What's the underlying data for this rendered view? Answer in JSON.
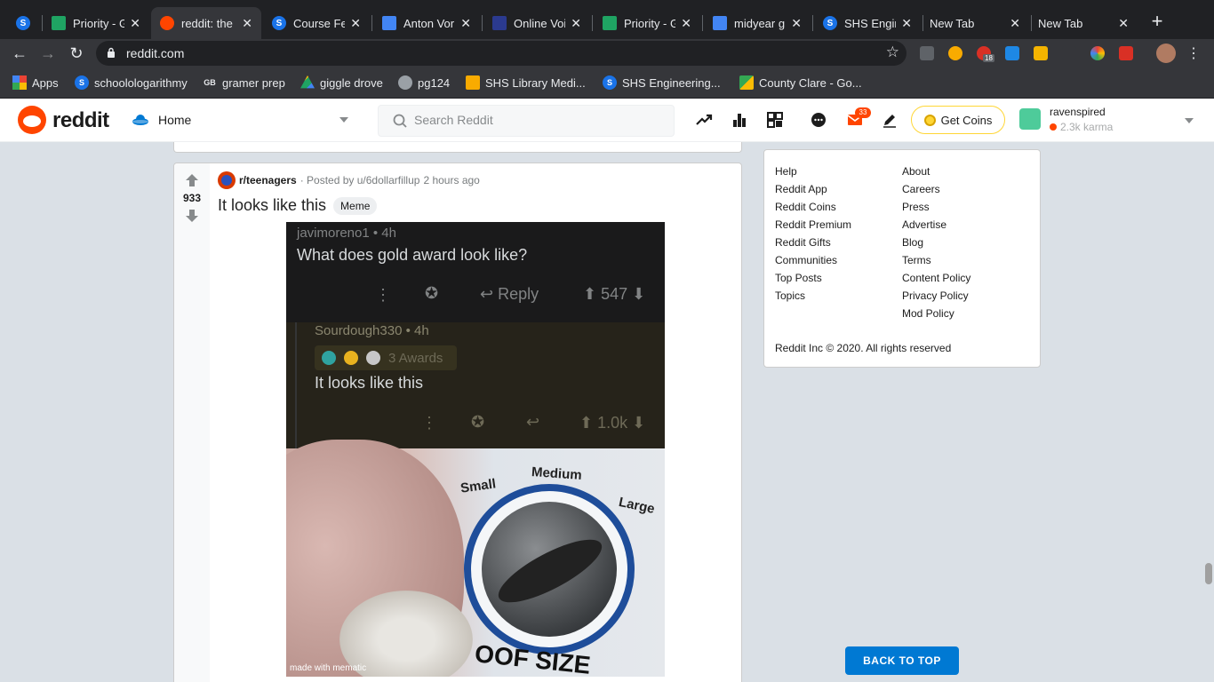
{
  "browser": {
    "tabs": [
      {
        "title": "",
        "favicon": "s-icon",
        "color": "#1a73e8"
      },
      {
        "title": "Priority - G",
        "favicon": "drive-icon",
        "color": "#1fa463"
      },
      {
        "title": "reddit: the",
        "favicon": "reddit-icon",
        "color": "#ff4500"
      },
      {
        "title": "Course Fe",
        "favicon": "s-icon",
        "color": "#1a73e8"
      },
      {
        "title": "Anton Vor",
        "favicon": "docs-icon",
        "color": "#4285f4"
      },
      {
        "title": "Online Voi",
        "favicon": "book-icon",
        "color": "#2b3a8f"
      },
      {
        "title": "Priority - G",
        "favicon": "drive-icon",
        "color": "#1fa463"
      },
      {
        "title": "midyear gr",
        "favicon": "docs-icon",
        "color": "#4285f4"
      },
      {
        "title": "SHS Engin",
        "favicon": "s-icon",
        "color": "#1a73e8"
      },
      {
        "title": "New Tab",
        "favicon": "",
        "color": ""
      },
      {
        "title": "New Tab",
        "favicon": "",
        "color": ""
      }
    ],
    "url": "reddit.com",
    "bookmarks": [
      {
        "label": "Apps",
        "icon": "apps-grid-icon"
      },
      {
        "label": "schoolologarithmy",
        "icon": "s-icon"
      },
      {
        "label": "gramer prep",
        "icon": "gb-icon"
      },
      {
        "label": "giggle drove",
        "icon": "drive-icon"
      },
      {
        "label": "pg124",
        "icon": "globe-icon"
      },
      {
        "label": "SHS Library Medi...",
        "icon": "library-icon"
      },
      {
        "label": "SHS Engineering...",
        "icon": "s-icon"
      },
      {
        "label": "County Clare - Go...",
        "icon": "maps-icon"
      }
    ],
    "extensions": {
      "badge": "18"
    }
  },
  "reddit_header": {
    "brand": "reddit",
    "feed_selector": "Home",
    "search_placeholder": "Search Reddit",
    "mail_badge": "33",
    "get_coins": "Get Coins",
    "username": "ravenspired",
    "karma": "2.3k karma"
  },
  "post": {
    "score": "933",
    "subreddit": "r/teenagers",
    "posted_by": "· Posted by u/6dollarfillup",
    "time": "2 hours ago",
    "title": "It looks like this",
    "flair": "Meme",
    "image": {
      "comment1": {
        "user": "javimoreno1 • 4h",
        "body": "What does gold award look like?",
        "reply": "Reply",
        "score": "547"
      },
      "comment2": {
        "user": "Sourdough330 • 4h",
        "awards": "3 Awards",
        "body": "It looks like this",
        "score": "1.0k"
      },
      "dial_labels": {
        "small": "Small",
        "medium": "Medium",
        "large": "Large"
      },
      "caption": "OOF SIZE",
      "watermark": "made with mematic"
    }
  },
  "sidebar": {
    "col1": [
      "Help",
      "Reddit App",
      "Reddit Coins",
      "Reddit Premium",
      "Reddit Gifts",
      "Communities",
      "Top Posts",
      "Topics"
    ],
    "col2": [
      "About",
      "Careers",
      "Press",
      "Advertise",
      "Blog",
      "Terms",
      "Content Policy",
      "Privacy Policy",
      "Mod Policy"
    ],
    "copyright": "Reddit Inc © 2020. All rights reserved"
  },
  "back_to_top": "BACK TO TOP"
}
